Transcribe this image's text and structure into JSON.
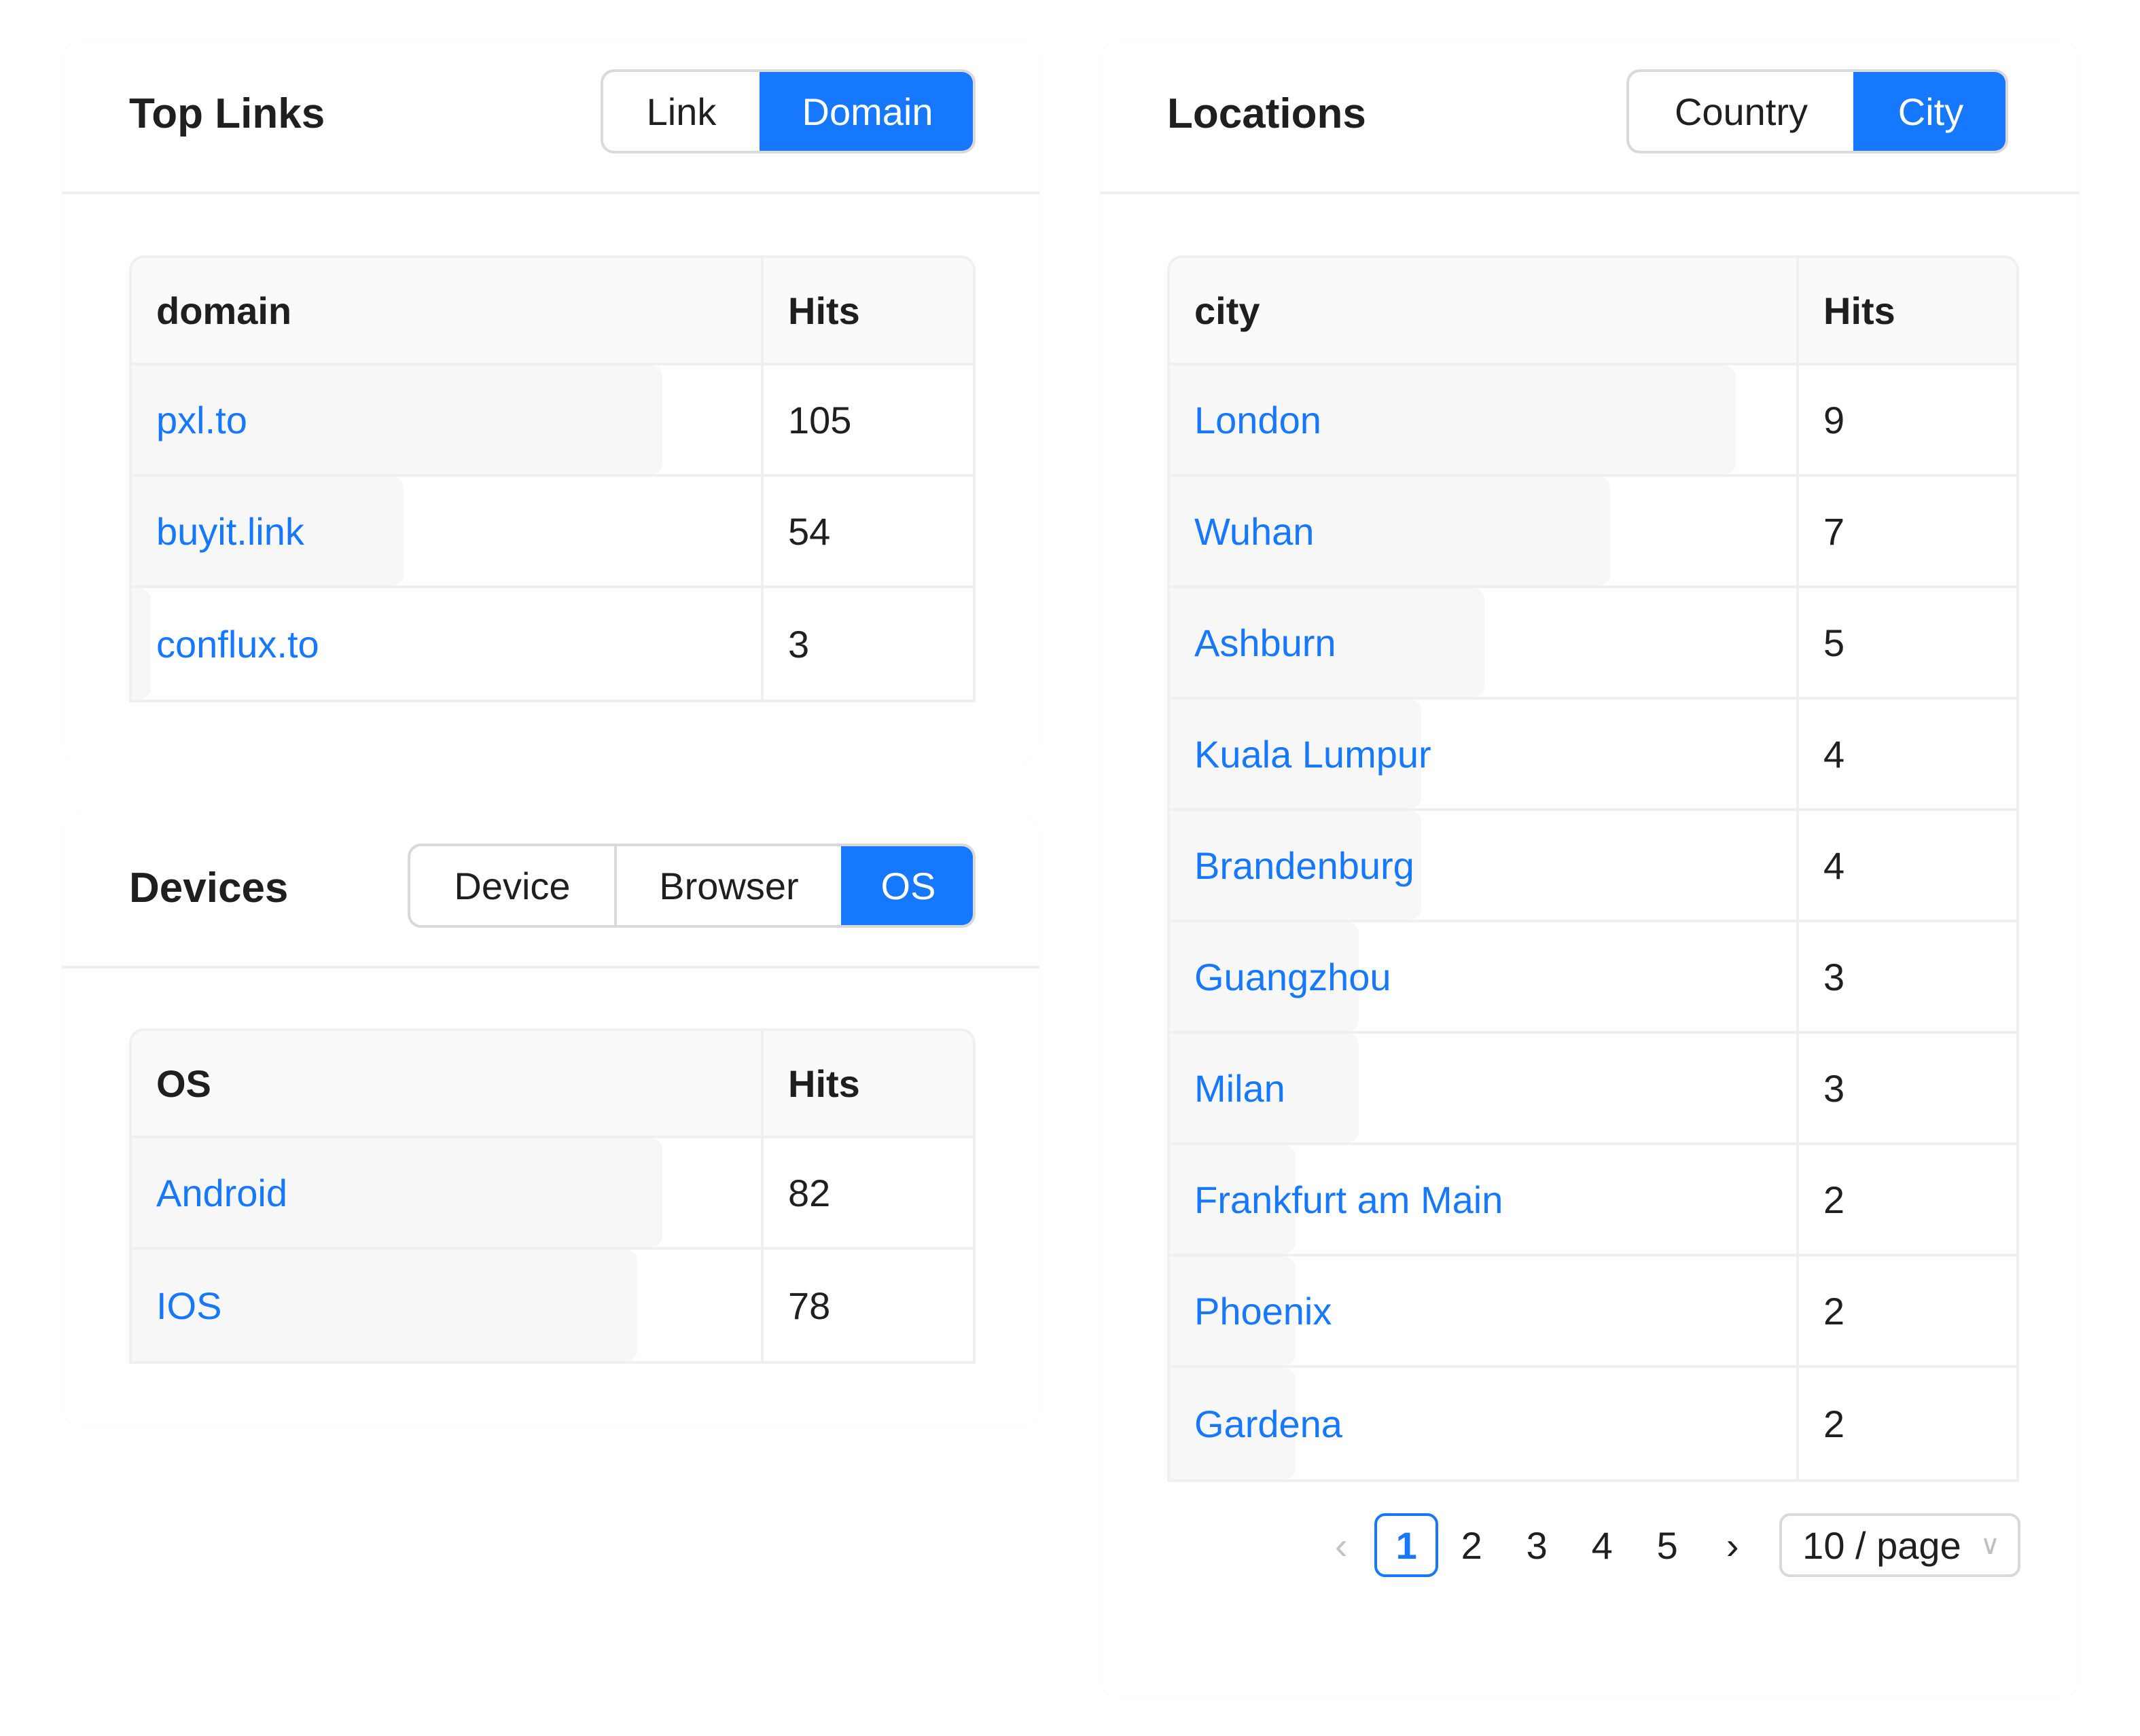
{
  "top_links": {
    "title": "Top Links",
    "tabs": [
      {
        "label": "Link",
        "active": false
      },
      {
        "label": "Domain",
        "active": true
      }
    ],
    "table": {
      "columns": [
        "domain",
        "Hits"
      ],
      "rows": [
        {
          "name": "pxl.to",
          "hits": "105",
          "share": 0.84
        },
        {
          "name": "buyit.link",
          "hits": "54",
          "share": 0.43
        },
        {
          "name": "conflux.to",
          "hits": "3",
          "share": 0.03
        }
      ]
    }
  },
  "devices": {
    "title": "Devices",
    "tabs": [
      {
        "label": "Device",
        "active": false
      },
      {
        "label": "Browser",
        "active": false
      },
      {
        "label": "OS",
        "active": true
      }
    ],
    "table": {
      "columns": [
        "OS",
        "Hits"
      ],
      "rows": [
        {
          "name": "Android",
          "hits": "82",
          "share": 0.84
        },
        {
          "name": "IOS",
          "hits": "78",
          "share": 0.8
        }
      ]
    }
  },
  "locations": {
    "title": "Locations",
    "tabs": [
      {
        "label": "Country",
        "active": false
      },
      {
        "label": "City",
        "active": true
      }
    ],
    "table": {
      "columns": [
        "city",
        "Hits"
      ],
      "rows": [
        {
          "name": "London",
          "hits": "9",
          "share": 0.9
        },
        {
          "name": "Wuhan",
          "hits": "7",
          "share": 0.7
        },
        {
          "name": "Ashburn",
          "hits": "5",
          "share": 0.5
        },
        {
          "name": "Kuala Lumpur",
          "hits": "4",
          "share": 0.4
        },
        {
          "name": "Brandenburg",
          "hits": "4",
          "share": 0.4
        },
        {
          "name": "Guangzhou",
          "hits": "3",
          "share": 0.3
        },
        {
          "name": "Milan",
          "hits": "3",
          "share": 0.3
        },
        {
          "name": "Frankfurt am Main",
          "hits": "2",
          "share": 0.2
        },
        {
          "name": "Phoenix",
          "hits": "2",
          "share": 0.2
        },
        {
          "name": "Gardena",
          "hits": "2",
          "share": 0.2
        }
      ]
    },
    "pagination": {
      "prev_icon": "chevron-left",
      "next_icon": "chevron-right",
      "pages": [
        "1",
        "2",
        "3",
        "4",
        "5"
      ],
      "current": "1",
      "page_size": "10 / page",
      "page_size_icon": "chevron-down"
    }
  },
  "colors": {
    "accent": "#1677ff",
    "text": "#1f1f1f",
    "border": "#f0f0f0",
    "bar": "#f7f7f7",
    "header_bg": "#fafafa"
  }
}
